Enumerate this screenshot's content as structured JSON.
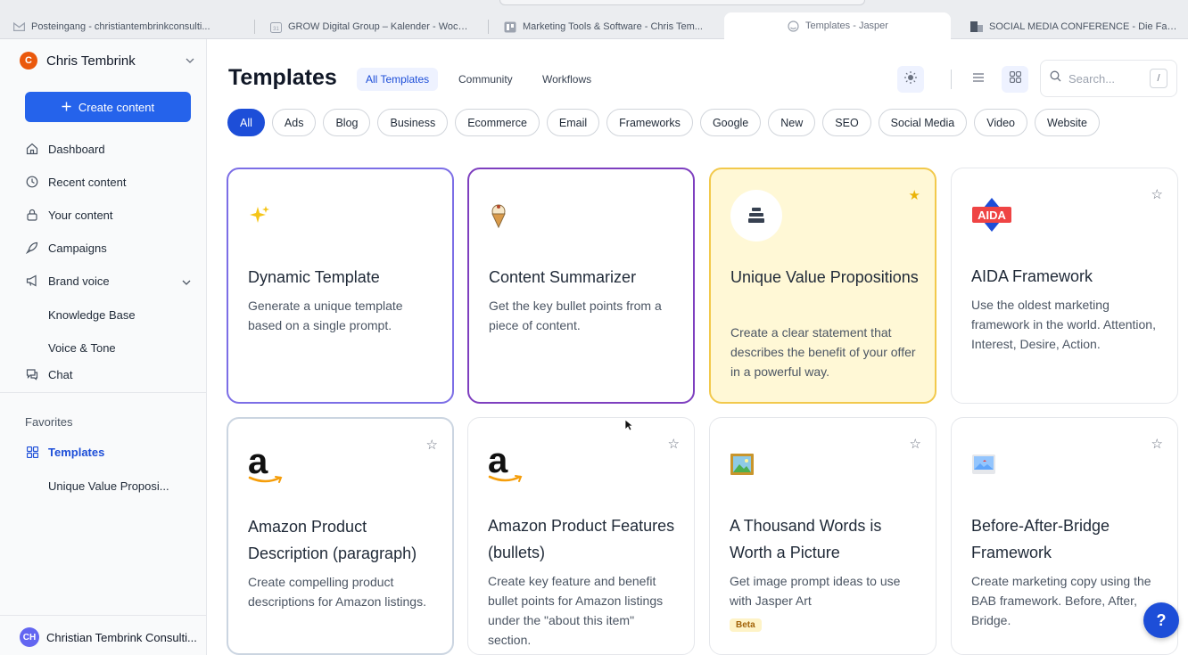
{
  "browser": {
    "tabs": [
      {
        "title": "Posteingang - christiantembrinkconsulti...",
        "icon": "gmail-icon",
        "left": 0
      },
      {
        "title": "GROW Digital Group – Kalender - Woche...",
        "icon": "calendar-icon",
        "left": 0
      },
      {
        "title": "Marketing Tools & Software - Chris Tem...",
        "icon": "docs-icon",
        "left": 0
      },
      {
        "title": "Templates - Jasper",
        "icon": "jasper-icon",
        "left": 0
      },
      {
        "title": "SOCIAL MEDIA CONFERENCE - Die Fach...",
        "icon": "site-icon",
        "left": 0
      }
    ]
  },
  "sidebar": {
    "account_name": "Chris Tembrink",
    "account_initial": "C",
    "create_label": "Create content",
    "items": [
      {
        "label": "Dashboard",
        "icon": "home-icon"
      },
      {
        "label": "Recent content",
        "icon": "clock-icon"
      },
      {
        "label": "Your content",
        "icon": "lock-icon"
      },
      {
        "label": "Campaigns",
        "icon": "rocket-icon"
      },
      {
        "label": "Brand voice",
        "icon": "megaphone-icon"
      },
      {
        "label": "Knowledge Base"
      },
      {
        "label": "Voice & Tone"
      },
      {
        "label": "Chat",
        "icon": "chat-icon"
      }
    ],
    "favorites_heading": "Favorites",
    "favorites": [
      {
        "label": "Templates",
        "icon": "grid-icon"
      },
      {
        "label": "Unique Value Proposi..."
      }
    ],
    "workspace_initials": "CH",
    "workspace_name": "Christian Tembrink Consulti..."
  },
  "header": {
    "title": "Templates",
    "tabs": [
      "All Templates",
      "Community",
      "Workflows"
    ],
    "search_placeholder": "Search...",
    "search_shortcut": "/"
  },
  "filters": [
    "All",
    "Ads",
    "Blog",
    "Business",
    "Ecommerce",
    "Email",
    "Frameworks",
    "Google",
    "New",
    "SEO",
    "Social Media",
    "Video",
    "Website"
  ],
  "cards": [
    {
      "title": "Dynamic Template",
      "desc": "Generate a unique template based on a single prompt.",
      "icon": "sparkles-icon"
    },
    {
      "title": "Content Summarizer",
      "desc": "Get the key bullet points from a piece of content.",
      "icon": "ice-cream-icon"
    },
    {
      "title": "Unique Value Propositions",
      "desc": "Create a clear statement that describes the benefit of your offer in a powerful way.",
      "icon": "stack-icon"
    },
    {
      "title": "AIDA Framework",
      "desc": "Use the oldest marketing framework in the world. Attention, Interest, Desire, Action.",
      "icon": "aida-logo-icon",
      "logo_text": "AIDA"
    },
    {
      "title": "Amazon Product Description (paragraph)",
      "desc": "Create compelling product descriptions for Amazon listings.",
      "icon": "amazon-logo-icon",
      "logo_text": "a"
    },
    {
      "title": "Amazon Product Features (bullets)",
      "desc": "Create key feature and benefit bullet points for Amazon listings under the \"about this item\" section.",
      "icon": "amazon-logo-icon",
      "logo_text": "a"
    },
    {
      "title": "A Thousand Words is Worth a Picture",
      "desc": "Get image prompt ideas to use with Jasper Art",
      "icon": "framed-picture-icon",
      "badge": "Beta"
    },
    {
      "title": "Before-After-Bridge Framework",
      "desc": "Create marketing copy using the BAB framework. Before, After, Bridge.",
      "icon": "landscape-icon"
    }
  ],
  "help_label": "?",
  "colors": {
    "accent": "#1d4ed8",
    "create": "#2563eb",
    "star": "#eab308",
    "highlight": "#fff8d6"
  }
}
